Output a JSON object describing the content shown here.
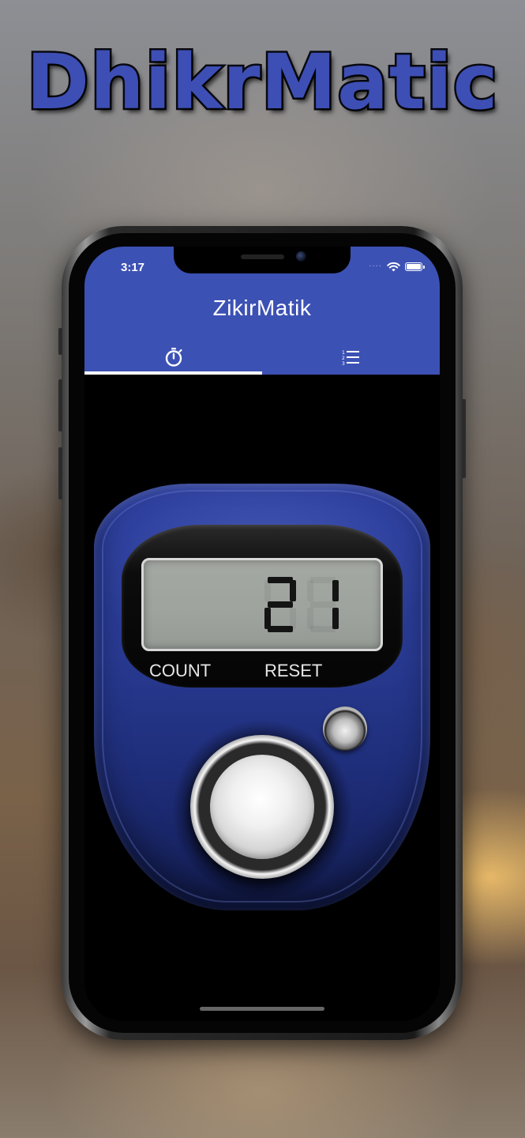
{
  "marketing": {
    "title": "DhikrMatic"
  },
  "status_bar": {
    "time": "3:17"
  },
  "app_bar": {
    "title": "ZikirMatik",
    "tabs": [
      {
        "icon": "stopwatch-icon",
        "selected": true
      },
      {
        "icon": "list-icon",
        "selected": false
      }
    ],
    "color": "#3c51b4"
  },
  "counter": {
    "value": "21",
    "count_label": "COUNT",
    "reset_label": "RESET"
  }
}
